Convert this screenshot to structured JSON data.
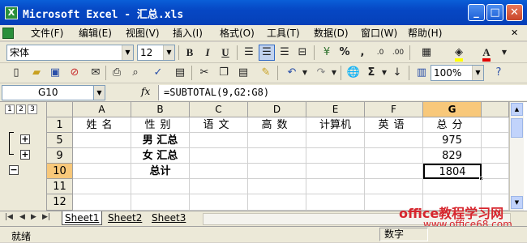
{
  "window": {
    "app_icon": "X",
    "title": "Microsoft Excel - 汇总.xls",
    "minimize": "_",
    "maximize": "□",
    "close": "✕"
  },
  "menu": {
    "items": [
      "文件(F)",
      "编辑(E)",
      "视图(V)",
      "插入(I)",
      "格式(O)",
      "工具(T)",
      "数据(D)",
      "窗口(W)",
      "帮助(H)"
    ],
    "close_glyph": "✕"
  },
  "format_toolbar": {
    "font_name": "宋体",
    "font_size": "12",
    "bold": "B",
    "italic": "I",
    "underline": "U",
    "percent": "%",
    "comma": ",",
    "font_color_letter": "A"
  },
  "standard_toolbar": {
    "zoom": "100%"
  },
  "formula_bar": {
    "name_box": "G10",
    "fx": "fx",
    "formula": "=SUBTOTAL(9,G2:G8)"
  },
  "outline": {
    "levels": [
      "1",
      "2",
      "3"
    ],
    "buttons": [
      "+",
      "+",
      "−"
    ]
  },
  "sheet": {
    "columns": [
      "A",
      "B",
      "C",
      "D",
      "E",
      "F",
      "G"
    ],
    "selected_column": "G",
    "rows": [
      {
        "num": "1",
        "cells": [
          "姓名",
          "性别",
          "语文",
          "高数",
          "计算机",
          "英语",
          "总分"
        ]
      },
      {
        "num": "5",
        "cells": [
          "",
          "男 汇总",
          "",
          "",
          "",
          "",
          "975"
        ]
      },
      {
        "num": "9",
        "cells": [
          "",
          "女 汇总",
          "",
          "",
          "",
          "",
          "829"
        ]
      },
      {
        "num": "10",
        "cells": [
          "",
          "总计",
          "",
          "",
          "",
          "",
          "1804"
        ]
      },
      {
        "num": "11",
        "cells": [
          "",
          "",
          "",
          "",
          "",
          "",
          ""
        ]
      },
      {
        "num": "12",
        "cells": [
          "",
          "",
          "",
          "",
          "",
          "",
          ""
        ]
      }
    ],
    "selected_row": "10",
    "active_cell": "G10"
  },
  "tabs": {
    "nav": [
      "|◀",
      "◀",
      "▶",
      "▶|"
    ],
    "sheets": [
      "Sheet1",
      "Sheet2",
      "Sheet3"
    ],
    "active": "Sheet1"
  },
  "status": {
    "left": "就绪",
    "right": "数字"
  },
  "watermark": {
    "line1": "office教程学习网",
    "line2": "www.office68.com"
  }
}
